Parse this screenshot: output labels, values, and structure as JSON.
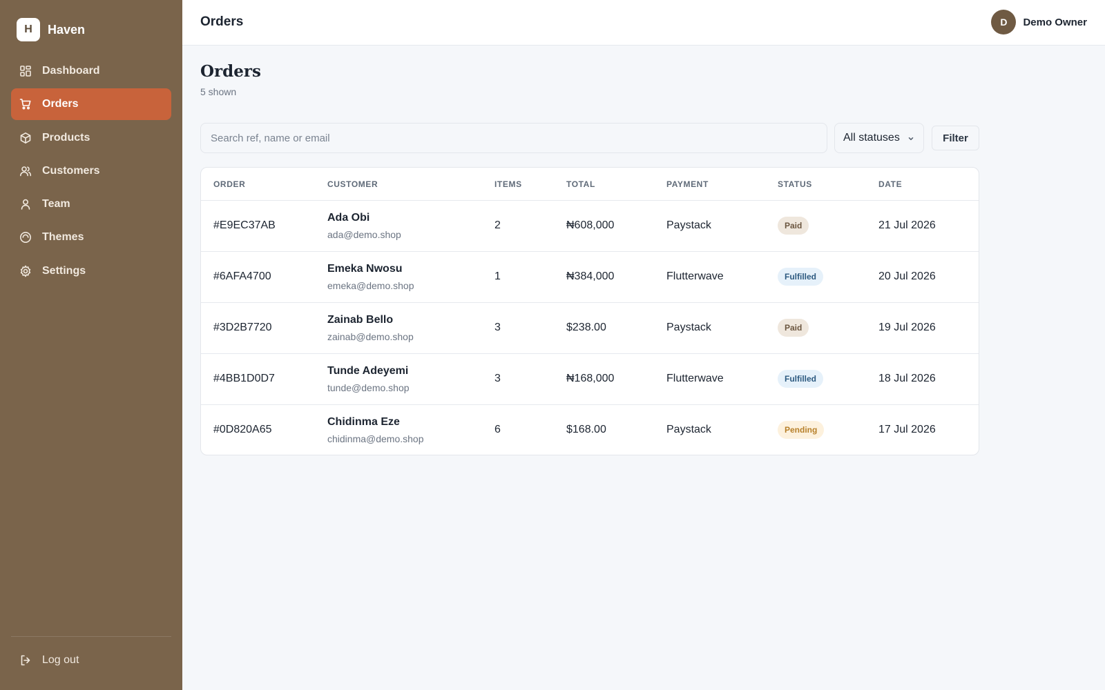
{
  "brand": {
    "logo_letter": "H",
    "name": "Haven"
  },
  "nav": {
    "items": [
      {
        "label": "Dashboard",
        "icon": "dashboard-icon",
        "active": false
      },
      {
        "label": "Orders",
        "icon": "cart-icon",
        "active": true
      },
      {
        "label": "Products",
        "icon": "box-icon",
        "active": false
      },
      {
        "label": "Customers",
        "icon": "users-icon",
        "active": false
      },
      {
        "label": "Team",
        "icon": "user-icon",
        "active": false
      },
      {
        "label": "Themes",
        "icon": "palette-icon",
        "active": false
      },
      {
        "label": "Settings",
        "icon": "gear-icon",
        "active": false
      }
    ],
    "logout_label": "Log out"
  },
  "topbar": {
    "title": "Orders",
    "user_initial": "D",
    "user_name": "Demo Owner"
  },
  "page": {
    "title": "Orders",
    "subtitle": "5 shown"
  },
  "toolbar": {
    "search_placeholder": "Search ref, name or email",
    "status_selected": "All statuses",
    "filter_label": "Filter"
  },
  "table": {
    "columns": [
      "ORDER",
      "CUSTOMER",
      "ITEMS",
      "TOTAL",
      "PAYMENT",
      "STATUS",
      "DATE"
    ],
    "rows": [
      {
        "order": "#E9EC37AB",
        "name": "Ada Obi",
        "email": "ada@demo.shop",
        "items": "2",
        "total": "₦608,000",
        "payment": "Paystack",
        "status": "Paid",
        "status_key": "paid",
        "date": "21 Jul 2026"
      },
      {
        "order": "#6AFA4700",
        "name": "Emeka Nwosu",
        "email": "emeka@demo.shop",
        "items": "1",
        "total": "₦384,000",
        "payment": "Flutterwave",
        "status": "Fulfilled",
        "status_key": "fulfilled",
        "date": "20 Jul 2026"
      },
      {
        "order": "#3D2B7720",
        "name": "Zainab Bello",
        "email": "zainab@demo.shop",
        "items": "3",
        "total": "$238.00",
        "payment": "Paystack",
        "status": "Paid",
        "status_key": "paid",
        "date": "19 Jul 2026"
      },
      {
        "order": "#4BB1D0D7",
        "name": "Tunde Adeyemi",
        "email": "tunde@demo.shop",
        "items": "3",
        "total": "₦168,000",
        "payment": "Flutterwave",
        "status": "Fulfilled",
        "status_key": "fulfilled",
        "date": "18 Jul 2026"
      },
      {
        "order": "#0D820A65",
        "name": "Chidinma Eze",
        "email": "chidinma@demo.shop",
        "items": "6",
        "total": "$168.00",
        "payment": "Paystack",
        "status": "Pending",
        "status_key": "pending",
        "date": "17 Jul 2026"
      }
    ]
  },
  "colors": {
    "sidebar": "#7a644b",
    "accent": "#c8633b",
    "avatar": "#6f5a43",
    "badge_paid": "#efe7dd",
    "badge_fulfilled": "#e6f1fa",
    "badge_pending": "#fdf1dd"
  }
}
